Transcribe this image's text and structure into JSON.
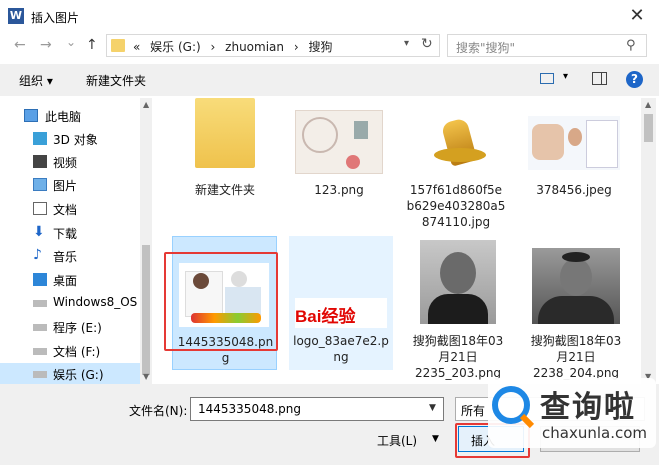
{
  "window": {
    "title": "插入图片",
    "app_icon_letter": "W",
    "close_glyph": "✕"
  },
  "nav": {
    "back": "←",
    "forward": "→",
    "dropdown": "⌄",
    "up": "↑",
    "breadcrumb": [
      "«",
      "娱乐 (G:)",
      "›",
      "zhuomian",
      "›",
      "搜狗"
    ],
    "search_placeholder": "搜索\"搜狗\""
  },
  "toolbar": {
    "organize": "组织 ▾",
    "new_folder": "新建文件夹",
    "help": "?"
  },
  "sidebar": {
    "items": [
      {
        "label": "此电脑",
        "icon": "computer-icon"
      },
      {
        "label": "3D 对象",
        "icon": "3d-objects-icon"
      },
      {
        "label": "视频",
        "icon": "video-icon"
      },
      {
        "label": "图片",
        "icon": "pictures-icon"
      },
      {
        "label": "文档",
        "icon": "documents-icon"
      },
      {
        "label": "下载",
        "icon": "download-icon"
      },
      {
        "label": "音乐",
        "icon": "music-icon"
      },
      {
        "label": "桌面",
        "icon": "desktop-icon"
      },
      {
        "label": "Windows8_OS",
        "icon": "drive-icon"
      },
      {
        "label": "程序 (E:)",
        "icon": "drive-icon"
      },
      {
        "label": "文档 (F:)",
        "icon": "drive-icon"
      },
      {
        "label": "娱乐 (G:)",
        "icon": "drive-icon"
      }
    ]
  },
  "files": [
    {
      "name": "新建文件夹",
      "type": "folder"
    },
    {
      "name": "123.png",
      "type": "certificate-image"
    },
    {
      "name": "157f61d860f5eb629e403280a5874110.jpg",
      "type": "gold-figure-image"
    },
    {
      "name": "378456.jpeg",
      "type": "doctor-image"
    },
    {
      "name": "1445335048.png",
      "type": "doctor-image",
      "selected": true
    },
    {
      "name": "logo_83ae7e2.png",
      "type": "baidu-logo-image",
      "logo_text": "Bai经验"
    },
    {
      "name": "搜狗截图18年03月21日2235_203.png",
      "type": "portrait-image"
    },
    {
      "name": "搜狗截图18年03月21日2238_204.png",
      "type": "portrait-image"
    }
  ],
  "file_lines": {
    "f0": [
      "新建文件夹"
    ],
    "f1": [
      "123.png"
    ],
    "f2": [
      "157f61d860f5e",
      "b629e403280a5",
      "874110.jpg"
    ],
    "f3": [
      "378456.jpeg"
    ],
    "f4": [
      "1445335048.pn",
      "g"
    ],
    "f5": [
      "logo_83ae7e2.p",
      "ng"
    ],
    "f6": [
      "搜狗截图18年03",
      "月21日",
      "2235_203.png"
    ],
    "f7": [
      "搜狗截图18年03",
      "月21日",
      "2238_204.png"
    ]
  },
  "bottom": {
    "filename_label": "文件名(N):",
    "filename_value": "1445335048.png",
    "filetype_value": "所有",
    "tools_label": "工具(L)",
    "insert_label": "插入",
    "cancel_label": ""
  },
  "watermark": {
    "cn": "查询啦",
    "en": "chaxunla.com"
  },
  "colors": {
    "accent": "#0078d7",
    "selection": "#cce8ff",
    "highlight_box": "#e53935",
    "folder": "#f5d26b"
  }
}
